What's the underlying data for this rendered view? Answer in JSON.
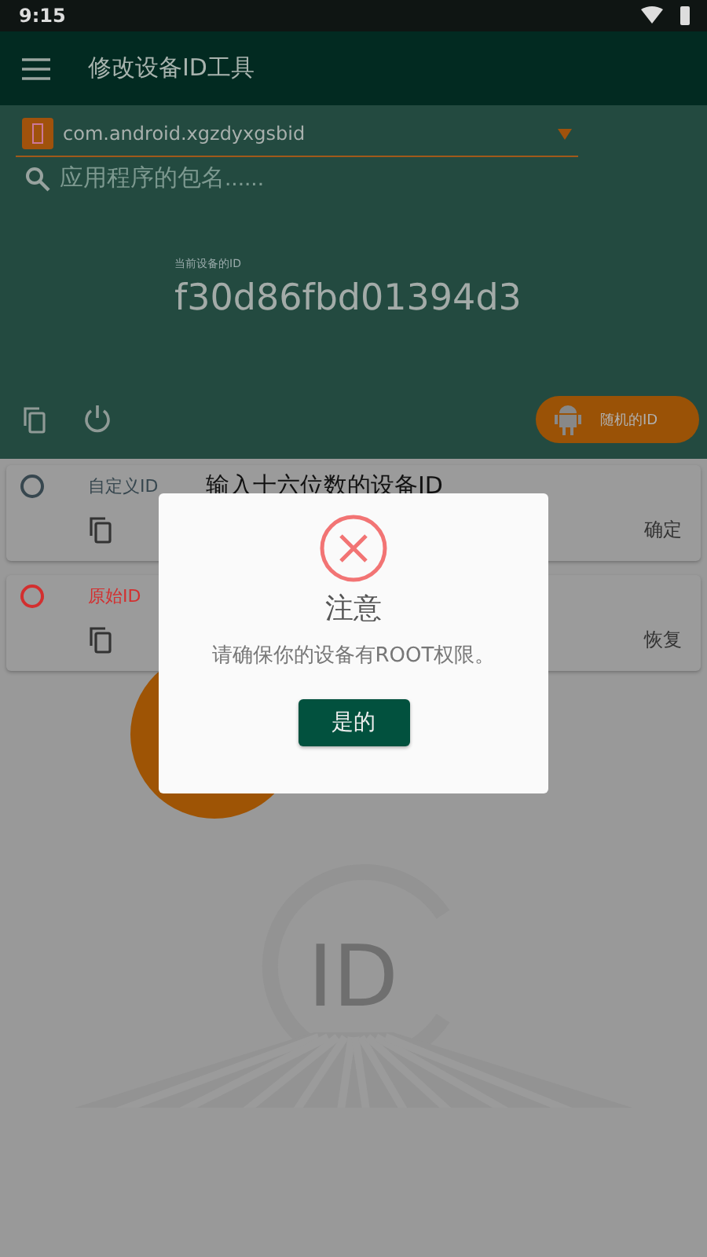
{
  "status_bar": {
    "time": "9:15"
  },
  "app_bar": {
    "title": "修改设备ID工具"
  },
  "package_select": {
    "value": "com.android.xgzdyxgsbid"
  },
  "search": {
    "placeholder": "应用程序的包名......"
  },
  "current_id": {
    "label": "当前设备的ID",
    "value": "f30d86fbd01394d3"
  },
  "random_button": {
    "label": "随机的ID"
  },
  "options": [
    {
      "label": "自定义ID",
      "color": "#37474f",
      "selected": false,
      "placeholder": "输入十六位数的设备ID",
      "action": "确定"
    },
    {
      "label": "原始ID",
      "color": "#d32f2f",
      "selected": false,
      "action": "恢复"
    }
  ],
  "logo": {
    "text": "ID"
  },
  "dialog": {
    "title": "注意",
    "message": "请确保你的设备有ROOT权限。",
    "button": "是的"
  }
}
